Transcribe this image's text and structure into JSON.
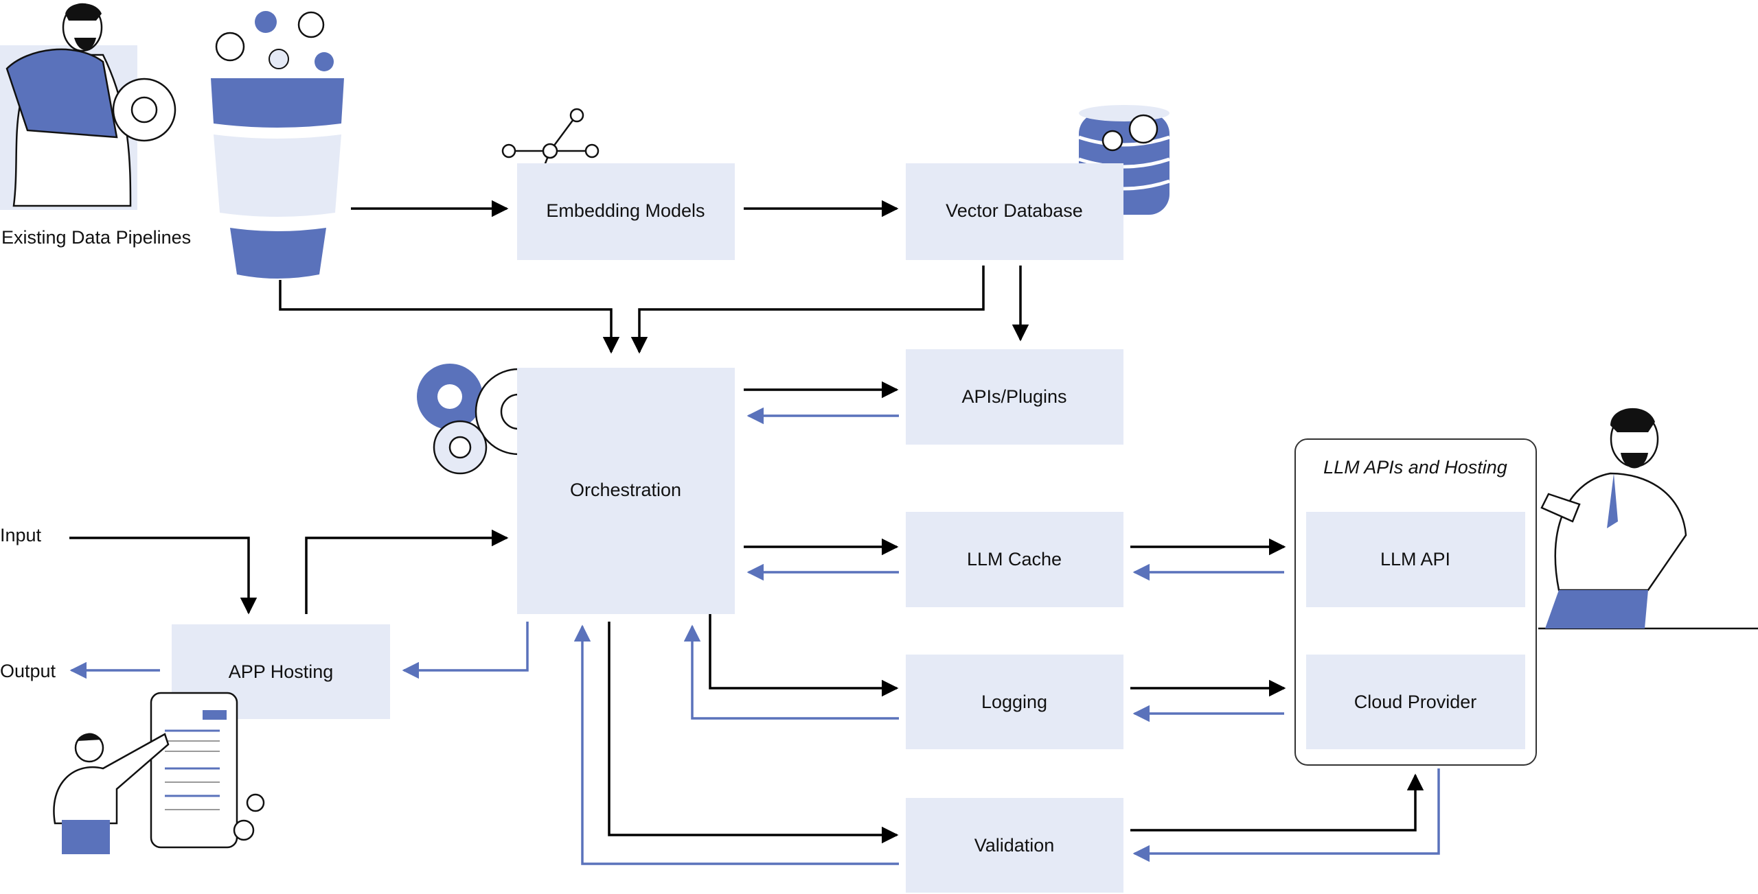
{
  "colors": {
    "box": "#e5eaf6",
    "accent": "#5a72bb",
    "flow": "#000000"
  },
  "labels": {
    "existing_pipelines": "Existing Data Pipelines",
    "embedding": "Embedding Models",
    "vector_db": "Vector Database",
    "orchestration": "Orchestration",
    "apis_plugins": "APIs/Plugins",
    "llm_cache": "LLM Cache",
    "logging": "Logging",
    "validation": "Validation",
    "app_hosting": "APP Hosting",
    "input": "Input",
    "output": "Output",
    "llm_group": "LLM APIs and Hosting",
    "llm_api": "LLM API",
    "cloud_provider": "Cloud Provider"
  },
  "icons": [
    "person-with-gear-illustration",
    "funnel-icon",
    "gear-icon",
    "network-node-icon",
    "database-icon",
    "person-with-phone-illustration",
    "presenter-person-illustration"
  ]
}
